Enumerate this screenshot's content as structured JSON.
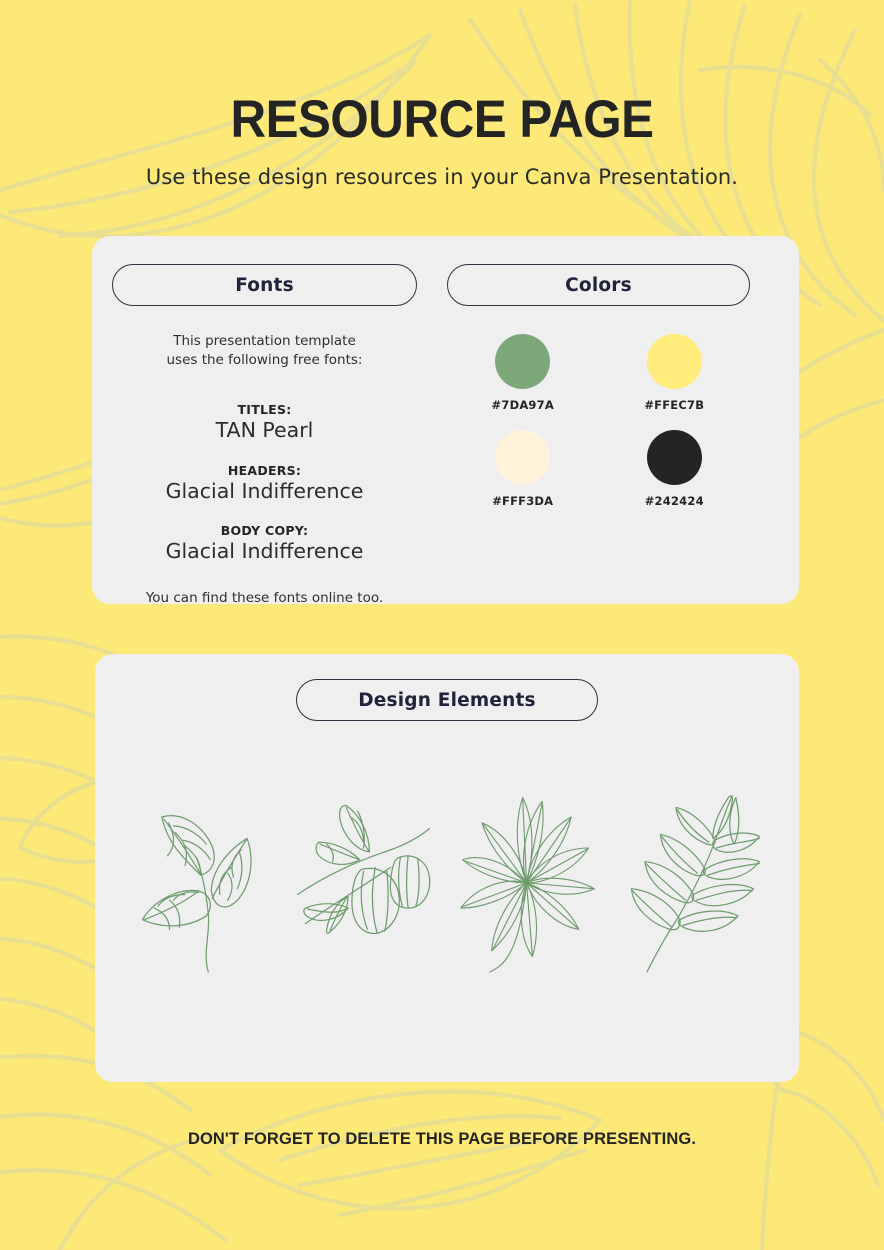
{
  "page": {
    "title": "RESOURCE PAGE",
    "subtitle": "Use these design resources in your Canva Presentation.",
    "footer_note": "DON'T FORGET TO DELETE THIS PAGE BEFORE PRESENTING.",
    "background_color": "#FCE978",
    "card_color": "#EFEFF0",
    "text_color": "#242424",
    "pattern_line_color": "#E8DF92"
  },
  "fonts_section": {
    "heading": "Fonts",
    "intro_line1": "This presentation template",
    "intro_line2": "uses the following free fonts:",
    "groups": [
      {
        "label": "TITLES:",
        "sample": "TAN Pearl"
      },
      {
        "label": "HEADERS:",
        "sample": "Glacial Indifference"
      },
      {
        "label": "BODY COPY:",
        "sample": "Glacial Indifference"
      }
    ],
    "outro": "You can find these fonts online too."
  },
  "colors_section": {
    "heading": "Colors",
    "swatches": [
      {
        "hex_label": "#7DA97A",
        "hex": "#7DA97A"
      },
      {
        "hex_label": "#FFEC7B",
        "hex": "#FFEC7B"
      },
      {
        "hex_label": "#FFF3DA",
        "hex": "#FFF3DA"
      },
      {
        "hex_label": "#242424",
        "hex": "#242424"
      }
    ]
  },
  "design_section": {
    "heading": "Design Elements",
    "illustration_color": "#6E9B6C",
    "elements": [
      {
        "name": "three-leaf-branch-illustration"
      },
      {
        "name": "fruit-branch-illustration"
      },
      {
        "name": "radial-palm-leaf-illustration"
      },
      {
        "name": "pinnate-fern-leaf-illustration"
      }
    ]
  }
}
